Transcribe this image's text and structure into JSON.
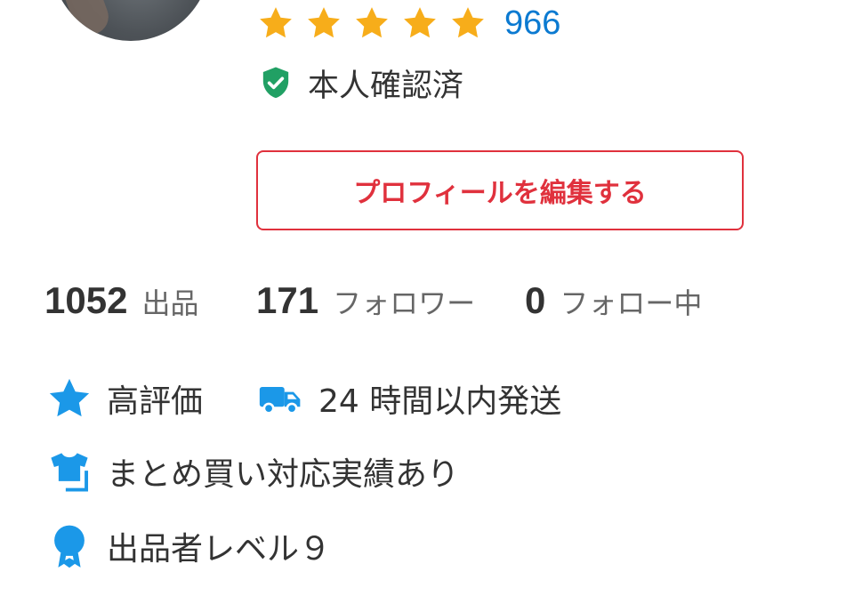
{
  "rating": {
    "stars": 5,
    "count": "966"
  },
  "verification": {
    "label": "本人確認済"
  },
  "edit_profile_button": {
    "label": "プロフィールを編集する"
  },
  "stats": [
    {
      "value": "1052",
      "label": "出品"
    },
    {
      "value": "171",
      "label": "フォロワー"
    },
    {
      "value": "0",
      "label": "フォロー中"
    }
  ],
  "badges": {
    "high_rating": "高評価",
    "fast_shipping": "24 時間以内発送",
    "bulk_purchase": "まとめ買い対応実績あり",
    "seller_level": "出品者レベル９"
  },
  "colors": {
    "star": "#f7ad1a",
    "link_blue": "#0b7ad1",
    "verified_green": "#21a064",
    "accent_red": "#e0313d",
    "badge_blue": "#1b98e8",
    "text": "#333333"
  },
  "icons": {
    "avatar": "avatar",
    "rating_star": "star-icon",
    "verified": "shield-check-icon",
    "high_rating": "star-icon",
    "fast_shipping": "truck-icon",
    "bulk_purchase": "tshirt-icon",
    "seller_level": "medal-icon"
  }
}
